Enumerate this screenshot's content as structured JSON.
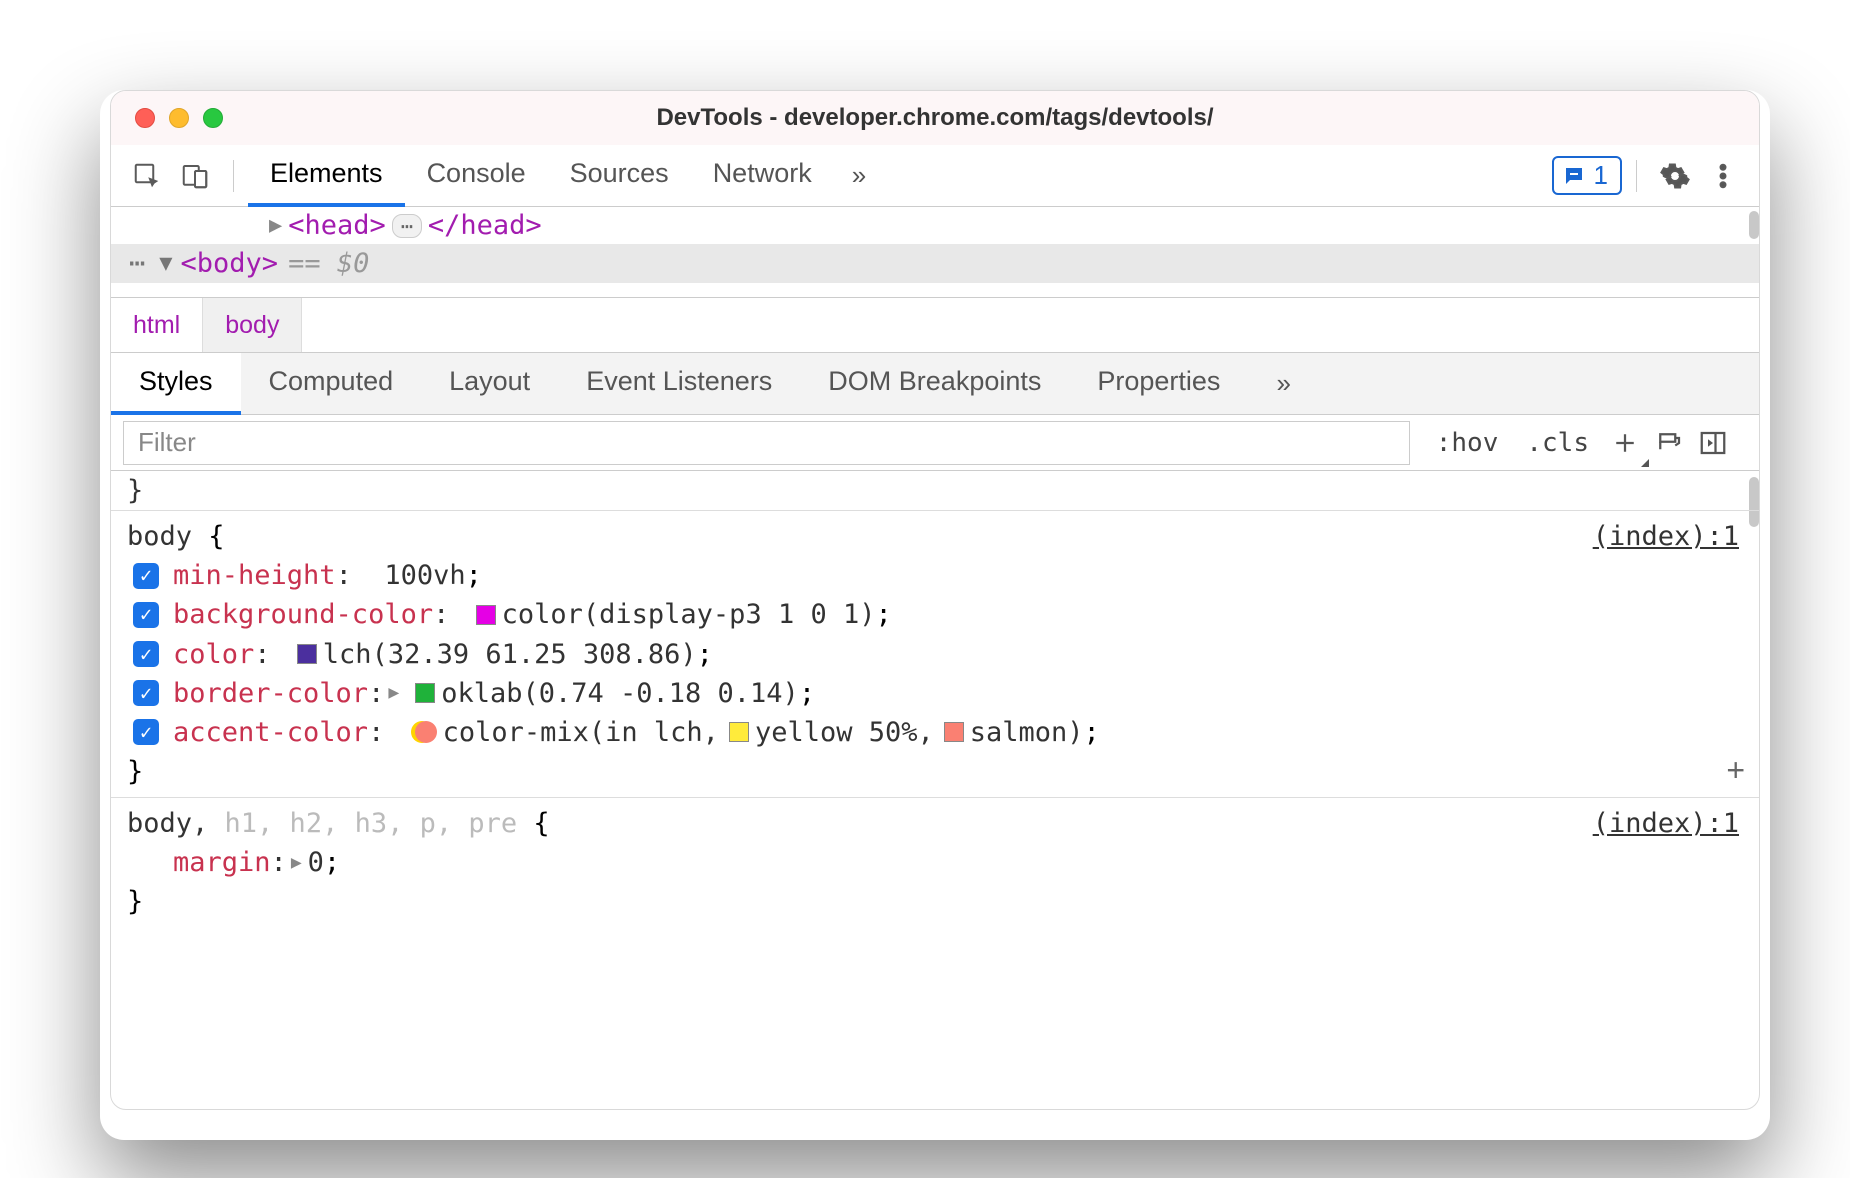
{
  "window": {
    "title": "DevTools - developer.chrome.com/tags/devtools/"
  },
  "main_tabs": [
    "Elements",
    "Console",
    "Sources",
    "Network"
  ],
  "main_tabs_active_index": 0,
  "issues_count": "1",
  "dom": {
    "head_open": "<head>",
    "head_close": "</head>",
    "body_open": "<body>",
    "selected_eq": "==",
    "selected_var": "$0"
  },
  "breadcrumbs": [
    "html",
    "body"
  ],
  "panel_tabs": [
    "Styles",
    "Computed",
    "Layout",
    "Event Listeners",
    "DOM Breakpoints",
    "Properties"
  ],
  "panel_tabs_active_index": 0,
  "filter": {
    "placeholder": "Filter",
    "hov": ":hov",
    "cls": ".cls"
  },
  "rules": [
    {
      "selector_primary": "body",
      "selector_dimmed": "",
      "source": "(index):1",
      "open_brace": " {",
      "close_brace": "}",
      "declarations": [
        {
          "name": "min-height",
          "value_parts": [
            {
              "text": "100vh"
            }
          ]
        },
        {
          "name": "background-color",
          "value_parts": [
            {
              "swatch": "#e500e5"
            },
            {
              "text": "color(display-p3 1 0 1)"
            }
          ]
        },
        {
          "name": "color",
          "value_parts": [
            {
              "swatch": "#4b2f9e"
            },
            {
              "text": "lch(32.39 61.25 308.86)"
            }
          ]
        },
        {
          "name": "border-color",
          "value_parts": [
            {
              "tri": true
            },
            {
              "swatch": "#1fb23a"
            },
            {
              "text": "oklab(0.74 -0.18 0.14)"
            }
          ]
        },
        {
          "name": "accent-color",
          "value_parts": [
            {
              "mix": {
                "c1": "#ffd400",
                "c2": "#fa8072"
              }
            },
            {
              "text": "color-mix(in lch, "
            },
            {
              "swatch": "#ffeb3b"
            },
            {
              "text": "yellow 50%, "
            },
            {
              "swatch": "#fa8072"
            },
            {
              "text": "salmon)"
            }
          ]
        }
      ]
    },
    {
      "selector_primary": "body,",
      "selector_dimmed": " h1, h2, h3, p, pre",
      "source": "(index):1",
      "open_brace": " {",
      "close_brace": "}",
      "declarations": [
        {
          "nocheck": true,
          "name": "margin",
          "value_parts": [
            {
              "tri": true
            },
            {
              "text": "0"
            }
          ]
        }
      ]
    }
  ],
  "glyphs": {
    "more": "»",
    "ellipsis": "⋯",
    "dots_pill": "⋯"
  }
}
